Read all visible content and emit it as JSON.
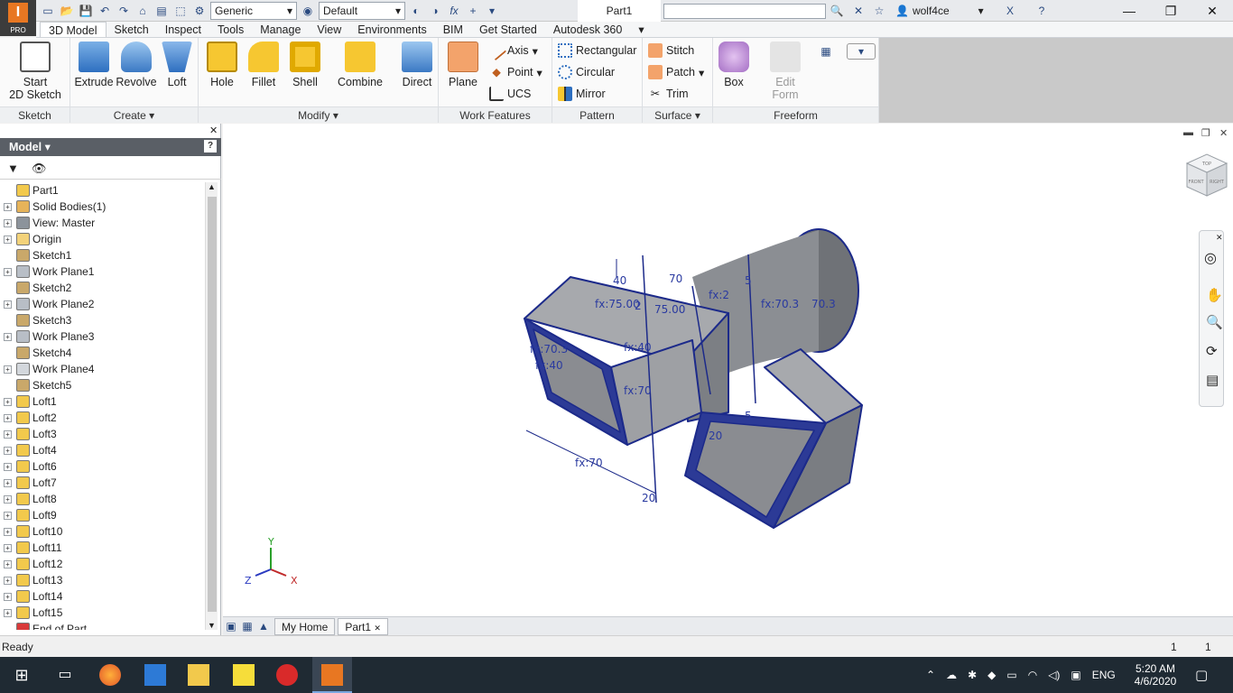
{
  "app": {
    "badge": "PRO",
    "logo_letter": "I"
  },
  "quick_access": {
    "material_value": "Generic",
    "appearance_value": "Default",
    "fx_label": "fx"
  },
  "document_title": "Part1",
  "user": {
    "name": "wolf4ce"
  },
  "window_controls": {
    "minimize": "—",
    "restore": "❐",
    "close": "✕"
  },
  "menu_tabs": [
    "3D Model",
    "Sketch",
    "Inspect",
    "Tools",
    "Manage",
    "View",
    "Environments",
    "BIM",
    "Get Started",
    "Autodesk 360"
  ],
  "ribbon": {
    "sketch": {
      "label": "Sketch",
      "start_line1": "Start",
      "start_line2": "2D Sketch"
    },
    "create": {
      "label": "Create",
      "extrude": "Extrude",
      "revolve": "Revolve",
      "loft": "Loft"
    },
    "modify": {
      "label": "Modify",
      "hole": "Hole",
      "fillet": "Fillet",
      "shell": "Shell",
      "combine": "Combine",
      "direct": "Direct"
    },
    "work_features": {
      "label": "Work Features",
      "plane": "Plane",
      "axis": "Axis",
      "point": "Point",
      "ucs": "UCS"
    },
    "pattern": {
      "label": "Pattern",
      "rectangular": "Rectangular",
      "circular": "Circular",
      "mirror": "Mirror"
    },
    "surface": {
      "label": "Surface",
      "stitch": "Stitch",
      "patch": "Patch",
      "trim": "Trim"
    },
    "freeform": {
      "label": "Freeform",
      "box": "Box",
      "edit_line1": "Edit",
      "edit_line2": "Form"
    }
  },
  "browser": {
    "title": "Model",
    "tree": [
      {
        "label": "Part1",
        "expand": false,
        "icon": "part-icon",
        "color": "#f2c94c"
      },
      {
        "label": "Solid Bodies(1)",
        "expand": true,
        "icon": "solid-bodies-icon",
        "color": "#e6b35a"
      },
      {
        "label": "View: Master",
        "expand": true,
        "icon": "view-icon",
        "color": "#8c939b"
      },
      {
        "label": "Origin",
        "expand": true,
        "icon": "folder-icon",
        "color": "#f3d27a"
      },
      {
        "label": "Sketch1",
        "expand": false,
        "icon": "sketch-icon",
        "color": "#c9a86a"
      },
      {
        "label": "Work Plane1",
        "expand": true,
        "icon": "work-plane-icon",
        "color": "#b8bec6"
      },
      {
        "label": "Sketch2",
        "expand": false,
        "icon": "sketch-icon",
        "color": "#c9a86a"
      },
      {
        "label": "Work Plane2",
        "expand": true,
        "icon": "work-plane-icon",
        "color": "#b8bec6"
      },
      {
        "label": "Sketch3",
        "expand": false,
        "icon": "sketch-icon",
        "color": "#c9a86a"
      },
      {
        "label": "Work Plane3",
        "expand": true,
        "icon": "work-plane-icon",
        "color": "#b8bec6"
      },
      {
        "label": "Sketch4",
        "expand": false,
        "icon": "sketch-icon",
        "color": "#c9a86a"
      },
      {
        "label": "Work Plane4",
        "expand": true,
        "icon": "work-plane-icon",
        "color": "#d3d7dc"
      },
      {
        "label": "Sketch5",
        "expand": false,
        "icon": "sketch-icon",
        "color": "#c9a86a"
      },
      {
        "label": "Loft1",
        "expand": true,
        "icon": "loft-icon",
        "color": "#f2c94c"
      },
      {
        "label": "Loft2",
        "expand": true,
        "icon": "loft-icon",
        "color": "#f2c94c"
      },
      {
        "label": "Loft3",
        "expand": true,
        "icon": "loft-icon",
        "color": "#f2c94c"
      },
      {
        "label": "Loft4",
        "expand": true,
        "icon": "loft-icon",
        "color": "#f2c94c"
      },
      {
        "label": "Loft6",
        "expand": true,
        "icon": "loft-icon",
        "color": "#f2c94c"
      },
      {
        "label": "Loft7",
        "expand": true,
        "icon": "loft-icon",
        "color": "#f2c94c"
      },
      {
        "label": "Loft8",
        "expand": true,
        "icon": "loft-icon",
        "color": "#f2c94c"
      },
      {
        "label": "Loft9",
        "expand": true,
        "icon": "loft-icon",
        "color": "#f2c94c"
      },
      {
        "label": "Loft10",
        "expand": true,
        "icon": "loft-icon",
        "color": "#f2c94c"
      },
      {
        "label": "Loft11",
        "expand": true,
        "icon": "loft-icon",
        "color": "#f2c94c"
      },
      {
        "label": "Loft12",
        "expand": true,
        "icon": "loft-icon",
        "color": "#f2c94c"
      },
      {
        "label": "Loft13",
        "expand": true,
        "icon": "loft-icon",
        "color": "#f2c94c"
      },
      {
        "label": "Loft14",
        "expand": true,
        "icon": "loft-icon",
        "color": "#f2c94c"
      },
      {
        "label": "Loft15",
        "expand": true,
        "icon": "loft-icon",
        "color": "#f2c94c"
      },
      {
        "label": "End of Part",
        "expand": false,
        "icon": "end-of-part-icon",
        "color": "#d93b3b"
      }
    ]
  },
  "viewcube": {
    "top": "TOP",
    "front": "FRONT",
    "right": "RIGHT"
  },
  "dimensions": {
    "d1": "40",
    "d2": "70",
    "d3": "fx:75.00",
    "d4": "fx:2",
    "d5": "5",
    "d6": "75.00",
    "d7": "fx:70.3",
    "d8": "70.3",
    "d9": "fx:70.3",
    "d10": "fx:40",
    "d11": "fx:40",
    "d12": "fx:70",
    "d13": "fx:70",
    "d14": "20",
    "d15": "5",
    "d16": "20",
    "d17": "2"
  },
  "triad": {
    "x": "X",
    "y": "Y",
    "z": "Z"
  },
  "doc_tabs": {
    "home": "My Home",
    "part": "Part1"
  },
  "status": {
    "text": "Ready",
    "count1": "1",
    "count2": "1"
  },
  "taskbar": {
    "language": "ENG",
    "time": "5:20 AM",
    "date": "4/6/2020"
  },
  "colors": {
    "model_edge": "#1c2a8a",
    "model_face": "#8d8f94",
    "accent": "#e87722"
  }
}
